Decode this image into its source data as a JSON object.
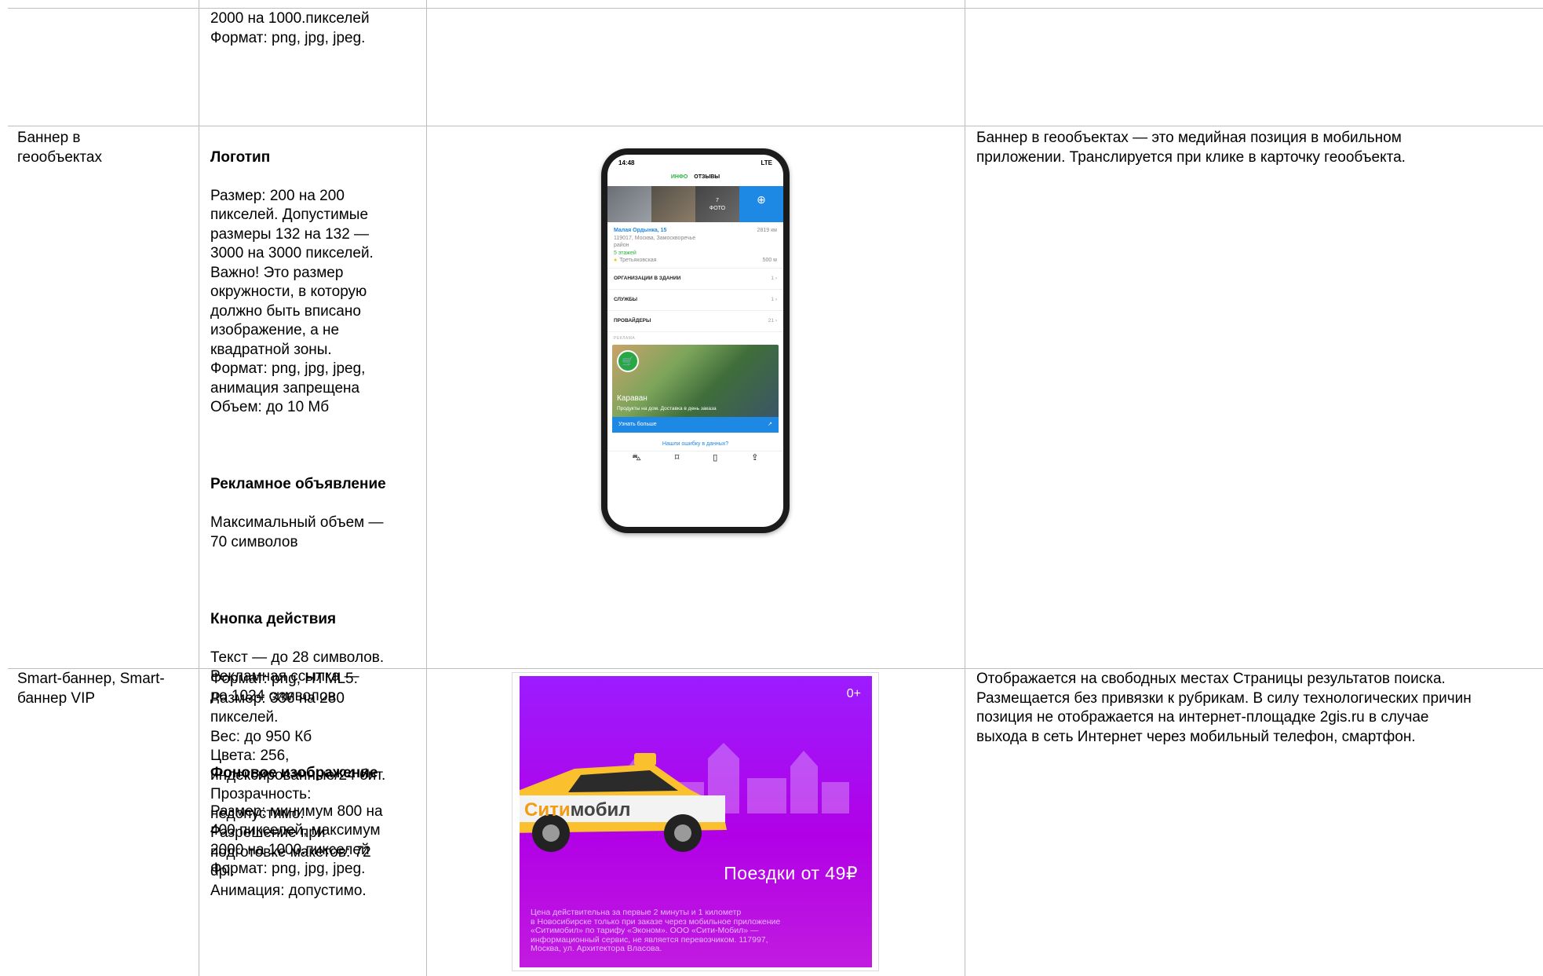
{
  "rows": {
    "row0": {
      "col2_lines": "2000 на 1000.пикселей\nФормат: png, jpg, jpeg."
    },
    "row1": {
      "name": "Баннер в\nгеообъектах",
      "logo_title": "Логотип",
      "logo_text": "Размер: 200 на 200\nпикселей. Допустимые\nразмеры 132 на 132 —\n3000 на 3000 пикселей.\nВажно! Это размер\nокружности, в которую\nдолжно быть вписано\nизображение, а не\nквадратной зоны.\nФормат: png, jpg, jpeg,\nанимация запрещена\nОбъем: до 10 Мб",
      "ad_title": "Рекламное объявление",
      "ad_text": "Максимальный объем —\n70 символов",
      "btn_title": "Кнопка действия",
      "btn_text": "Текст — до 28 символов.\nРекламная ссылка —\nдо 1024 символов",
      "bg_title": "Фоновое изображение",
      "bg_text": "Размер: минимум 800 на\n400 пикселей, максимум\n2000 на 1000.пикселей\nФормат: png, jpg, jpeg.",
      "description": "Баннер в геообъектах — это медийная позиция в мобильном\nприложении. Транслируется при клике в карточку геообъекта.",
      "phone": {
        "time": "14:48",
        "signal": "LTE",
        "tab_info": "ИНФО",
        "tab_reviews": "ОТЗЫВЫ",
        "photo_count": "7\nФОТО",
        "address_title": "Малая Ордынка, 15",
        "distance": "2819 км",
        "address_line": "119017, Москва, Замоскворечье\nрайон",
        "floors": "5 этажей",
        "metro": "Третьяковская",
        "metro_dist": "500 м",
        "list": [
          {
            "label": "ОРГАНИЗАЦИИ В ЗДАНИИ",
            "count": "1"
          },
          {
            "label": "СЛУЖБЫ",
            "count": "1"
          },
          {
            "label": "ПРОВАЙДЕРЫ",
            "count": "21"
          }
        ],
        "ad_label": "РЕКЛАМА",
        "ad_name": "Караван",
        "ad_sub": "Продукты на дом. Доставка в день заказа",
        "ad_button": "Узнать больше",
        "error_link": "Нашли ошибку в данных?"
      }
    },
    "row2": {
      "name": "Smart-баннер, Smart-\nбаннер VIP",
      "specs": "Формат: png, HTML5.\nРазмер: 336 на 280\nпикселей.\nВес: до 950 Кб\nЦвета: 256,\nиндексированные/24 бит.\nПрозрачность:\nнедопустимо.\nРазрешение при\nподготовке макетов: 72\ndpi.\nАнимация: допустимо.",
      "description": "Отображается на свободных местах Страницы результатов поиска.\nРазмещается без привязки к рубрикам. В силу технологических причин\nпозиция не отображается на интернет-площадке 2gis.ru в случае\nвыхода в сеть Интернет через мобильный телефон, смартфон.",
      "banner": {
        "age": "0+",
        "brand_a": "Сити",
        "brand_b": "мобил",
        "headline": "Поездки от 49₽",
        "fine_print": "Цена действительна за первые 2 минуты и 1 километр\nв Новосибирске только при заказе через мобильное приложение\n«Ситимобил» по тарифу «Эконом». ООО «Сити-Мобил» —\nинформационный сервис, не является перевозчиком. 117997,\nМосква, ул. Архитектора Власова."
      }
    }
  }
}
